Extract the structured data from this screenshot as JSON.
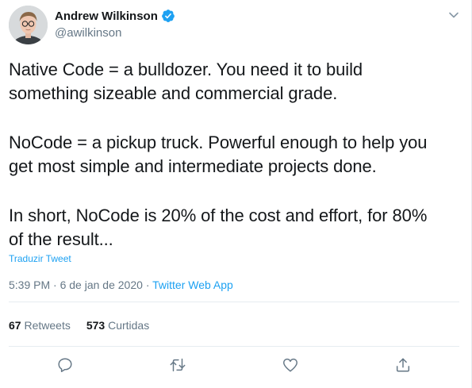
{
  "author": {
    "name": "Andrew Wilkinson",
    "handle": "@awilkinson",
    "verified": true
  },
  "tweet": {
    "lines": [
      "Native Code = a bulldozer. You need it to build",
      "something sizeable and commercial grade.",
      "NoCode = a pickup truck. Powerful enough to help you",
      "get most simple and intermediate projects done.",
      "In short, NoCode is 20% of the cost and effort, for 80%",
      "of the result..."
    ],
    "translate_label": "Traduzir Tweet",
    "time": "5:39 PM",
    "separator": "·",
    "date": "6 de jan de 2020",
    "source": "Twitter Web App"
  },
  "stats": {
    "retweets_count": "67",
    "retweets_label": "Retweets",
    "likes_count": "573",
    "likes_label": "Curtidas"
  },
  "icons": {
    "menu": "chevron-down-icon",
    "reply": "reply-icon",
    "retweet": "retweet-icon",
    "like": "heart-icon",
    "share": "share-icon"
  },
  "colors": {
    "accent": "#1da1f2",
    "text": "#14171a",
    "secondary": "#657786",
    "divider": "#e6ecf0"
  }
}
